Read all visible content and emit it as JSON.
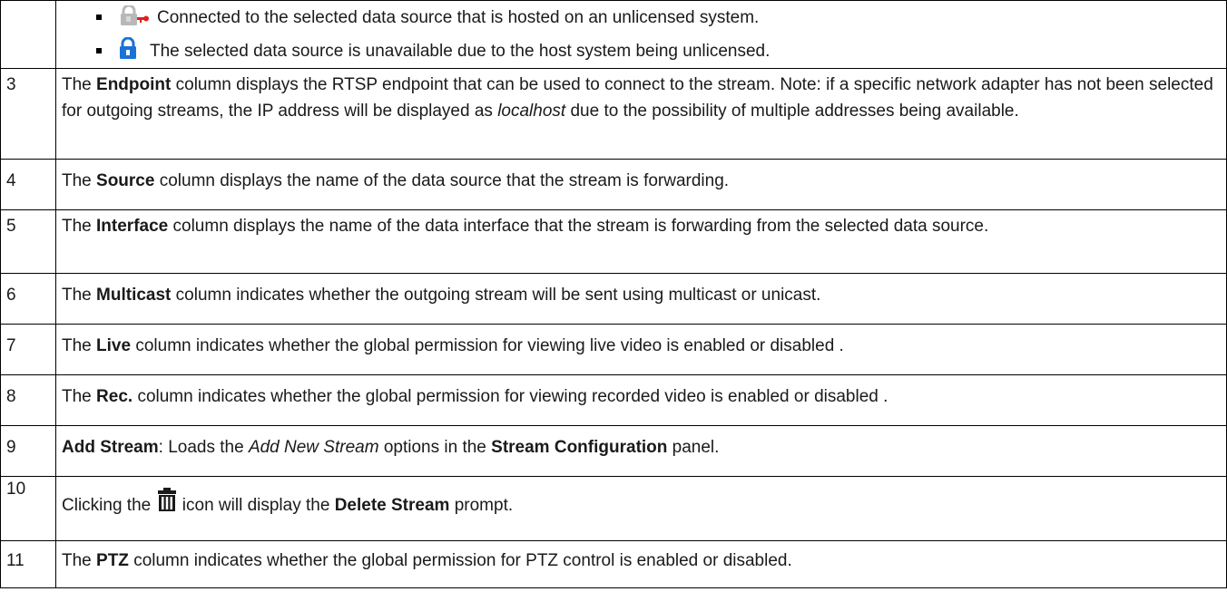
{
  "bullet_rows": [
    {
      "icon": "unlicensed-connected-icon",
      "text": "Connected to the selected data source that is hosted on an unlicensed system."
    },
    {
      "icon": "unlicensed-lock-icon",
      "text": "The selected data source is unavailable due to the host system being unlicensed."
    }
  ],
  "rows": {
    "r3": {
      "num": "3",
      "pre": "The ",
      "bold": "Endpoint",
      "mid": " column displays the RTSP endpoint that can be used to connect to the stream.  Note: if a specific network adapter has not been selected for outgoing streams, the IP address will be displayed as ",
      "italic": "localhost",
      "post": " due to the possibility of multiple addresses being available."
    },
    "r4": {
      "num": "4",
      "pre": "The ",
      "bold": "Source",
      "post": " column displays the name of the data source that the stream is forwarding."
    },
    "r5": {
      "num": "5",
      "pre": "The ",
      "bold": "Interface",
      "post": " column displays the name of the data interface that the stream is forwarding from the selected data source."
    },
    "r6": {
      "num": "6",
      "pre": "The ",
      "bold": "Multicast",
      "post": " column indicates whether the outgoing stream will be sent using multicast or unicast."
    },
    "r7": {
      "num": "7",
      "pre": "The ",
      "bold": "Live",
      "post": " column indicates whether the global permission for viewing live video is enabled or disabled ."
    },
    "r8": {
      "num": "8",
      "pre": "The ",
      "bold": "Rec.",
      "post": " column indicates whether the global permission for viewing recorded video is enabled or disabled ."
    },
    "r9": {
      "num": "9",
      "bold": "Add Stream",
      "mid": ": Loads the ",
      "italic": "Add New Stream",
      "post": " options in the ",
      "bold2": "Stream Configuration",
      "post2": " panel."
    },
    "r10": {
      "num": "10",
      "pre": "Clicking the ",
      "icon": "trash-icon",
      "mid": " icon will display the ",
      "bold": "Delete Stream",
      "post": " prompt."
    },
    "r11": {
      "num": "11",
      "pre": "The ",
      "bold": "PTZ",
      "post": " column indicates whether the global permission for PTZ control is enabled or disabled."
    }
  },
  "colors": {
    "lock_blue": "#1a73d6",
    "lock_gray": "#b8b8b8",
    "key_red": "#e02020",
    "trash": "#1a1a1a"
  }
}
